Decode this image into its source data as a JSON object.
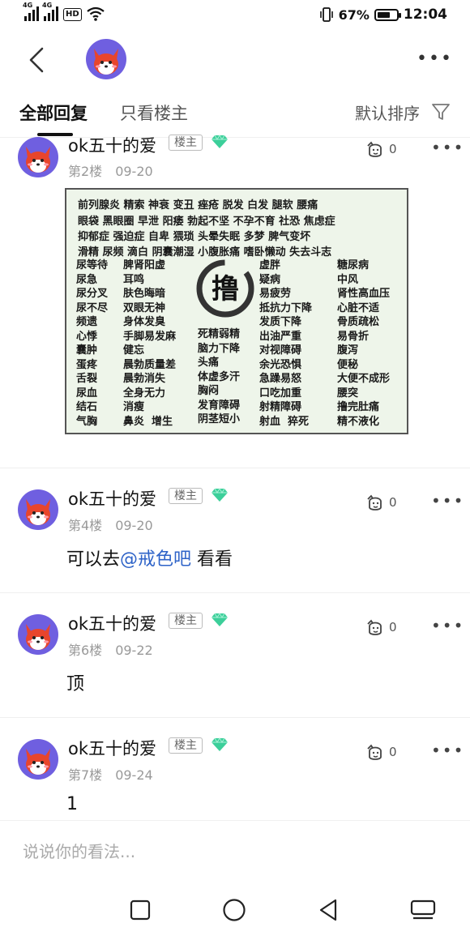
{
  "status_bar": {
    "net1": "4G",
    "net2": "4G",
    "hd": "HD",
    "battery_pct_text": "67%",
    "battery_level": 0.67,
    "time": "12:04"
  },
  "tabs": {
    "all_replies": "全部回复",
    "owner_only": "只看楼主",
    "sort": "默认排序"
  },
  "posts": [
    {
      "username": "ok五十的爱",
      "badge": "楼主",
      "floor": "第2楼",
      "date": "09-20",
      "likes": "0",
      "image": {
        "rows": [
          "前列腺炎 精索 神衰 变丑 痤疮 脱发 白发 腿软 腰痛",
          "眼袋 黑眼圈 早泄 阳痿 勃起不坚 不孕不育 社恐 焦虑症",
          "抑郁症 强迫症 自卑 猥琐 头晕失眠 多梦 脾气变坏",
          "滑精 尿频 滴白 阴囊潮湿 小腹胀痛 嗜卧懒动 失去斗志"
        ],
        "col1": [
          "尿等待",
          "尿急",
          "尿分叉",
          "尿不尽",
          "频遗",
          "心悸",
          "囊肿",
          "蛋疼",
          "舌裂",
          "尿血",
          "结石",
          "气胸"
        ],
        "col2": [
          "脾肾阳虚",
          "耳鸣",
          "肤色晦暗",
          "双眼无神",
          "身体发臭",
          "手脚易发麻",
          "健忘",
          "晨勃质量差",
          "晨勃消失",
          "全身无力",
          "消瘦",
          "鼻炎  增生"
        ],
        "col3": [
          "死精弱精",
          "脑力下降",
          "头痛",
          "体虚多汗",
          "胸闷",
          "发育障碍",
          "阴茎短小"
        ],
        "col4": [
          "虚胖",
          "疑病",
          "易疲劳",
          "抵抗力下降",
          "发质下降",
          "出油严重",
          "对视障碍",
          "余光恐惧",
          "急躁易怒",
          "口吃加重",
          "射精障碍",
          "射血  猝死"
        ],
        "col5": [
          "糖尿病",
          "中风",
          "肾性高血压",
          "心脏不适",
          "骨质疏松",
          "易骨折",
          "腹泻",
          "便秘",
          "大便不成形",
          "腰突",
          "撸完肚痛",
          "精不液化"
        ],
        "center_char": "撸"
      }
    },
    {
      "username": "ok五十的爱",
      "badge": "楼主",
      "floor": "第4楼",
      "date": "09-20",
      "likes": "0",
      "text_before": "可以去",
      "mention": "@戒色吧",
      "text_after": " 看看"
    },
    {
      "username": "ok五十的爱",
      "badge": "楼主",
      "floor": "第6楼",
      "date": "09-22",
      "likes": "0",
      "text": "顶"
    },
    {
      "username": "ok五十的爱",
      "badge": "楼主",
      "floor": "第7楼",
      "date": "09-24",
      "likes": "0",
      "text": "1"
    }
  ],
  "input": {
    "placeholder": "说说你的看法..."
  },
  "colors": {
    "mention": "#2e63c8",
    "gem": "#3ccf9a",
    "avatar_bg": "#6f5fe0",
    "avatar_fox": "#e8452c"
  }
}
